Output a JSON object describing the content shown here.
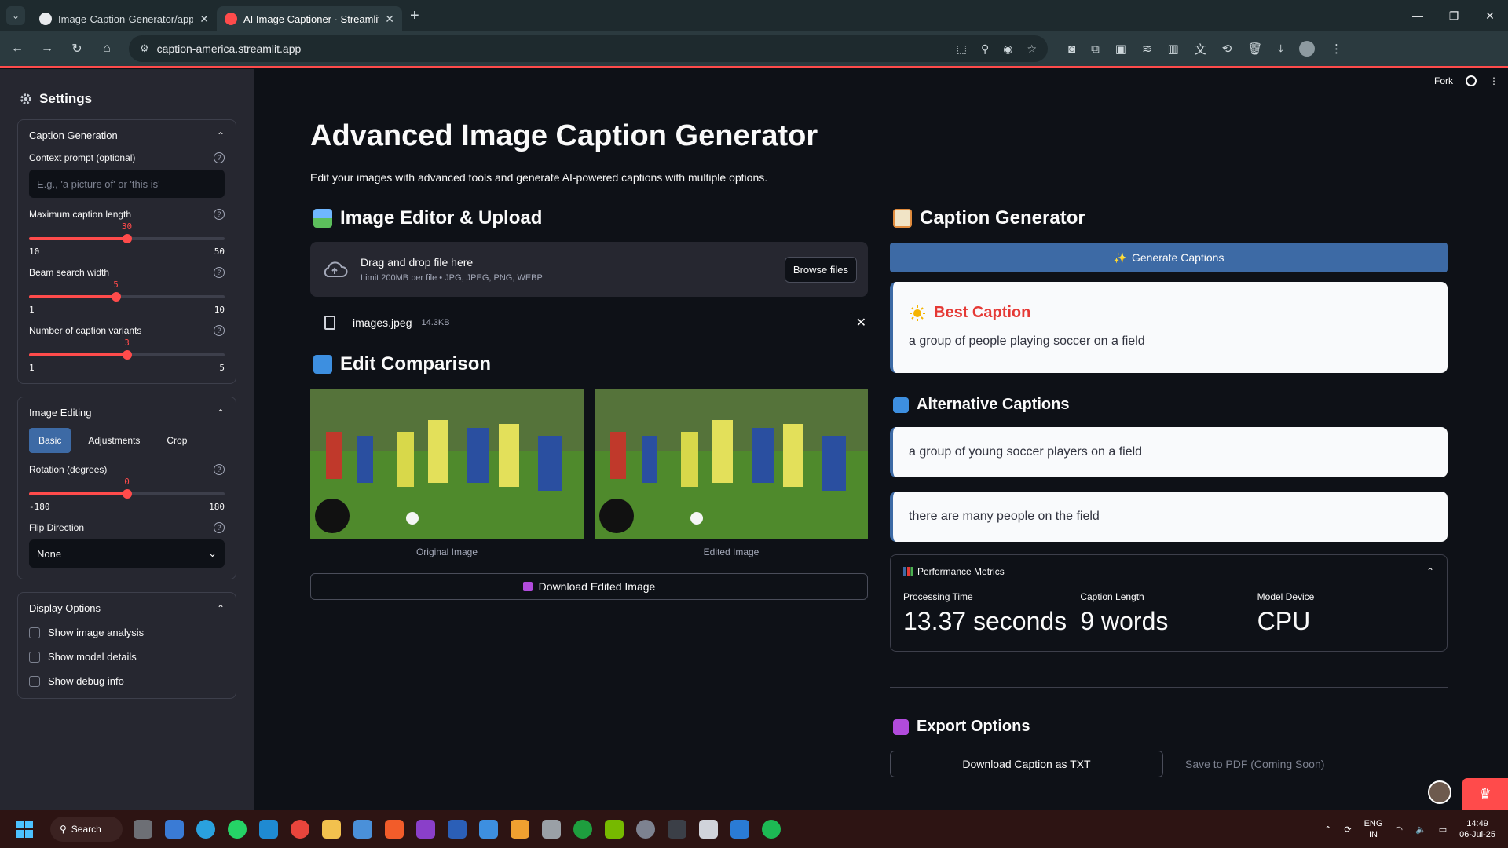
{
  "browser": {
    "tabs": [
      {
        "title": "Image-Caption-Generator/app",
        "active": false
      },
      {
        "title": "AI Image Captioner · Streamlit",
        "active": true
      }
    ],
    "url": "caption-america.streamlit.app"
  },
  "sidebar": {
    "title": "Settings",
    "caption_generation": {
      "header": "Caption Generation",
      "context_label": "Context prompt (optional)",
      "context_placeholder": "E.g., 'a picture of' or 'this is'",
      "max_len": {
        "label": "Maximum caption length",
        "value": "30",
        "min": "10",
        "max": "50",
        "fraction": 0.5
      },
      "beam": {
        "label": "Beam search width",
        "value": "5",
        "min": "1",
        "max": "10",
        "fraction": 0.444
      },
      "variants": {
        "label": "Number of caption variants",
        "value": "3",
        "min": "1",
        "max": "5",
        "fraction": 0.5
      }
    },
    "image_editing": {
      "header": "Image Editing",
      "tabs": [
        "Basic",
        "Adjustments",
        "Crop"
      ],
      "rotation": {
        "label": "Rotation (degrees)",
        "value": "0",
        "min": "-180",
        "max": "180",
        "fraction": 0.5
      },
      "flip_label": "Flip Direction",
      "flip_value": "None"
    },
    "display_options": {
      "header": "Display Options",
      "checks": [
        "Show image analysis",
        "Show model details",
        "Show debug info"
      ]
    }
  },
  "main": {
    "fork": "Fork",
    "title": "Advanced Image Caption Generator",
    "subtitle": "Edit your images with advanced tools and generate AI-powered captions with multiple options.",
    "editor_header": "Image Editor & Upload",
    "upload_main": "Drag and drop file here",
    "upload_limit": "Limit 200MB per file • JPG, JPEG, PNG, WEBP",
    "browse": "Browse files",
    "file_name": "images.jpeg",
    "file_size": "14.3KB",
    "compare_header": "Edit Comparison",
    "original_caption": "Original Image",
    "edited_caption": "Edited Image",
    "download_image": "Download Edited Image",
    "caption_header": "Caption Generator",
    "generate": "Generate Captions",
    "best_label": "Best Caption",
    "best_caption": "a group of people playing soccer on a field",
    "alt_header": "Alternative Captions",
    "alt_captions": [
      "a group of young soccer players on a field",
      "there are many people on the field"
    ],
    "metrics": {
      "header": "Performance Metrics",
      "items": [
        {
          "label": "Processing Time",
          "value": "13.37 seconds"
        },
        {
          "label": "Caption Length",
          "value": "9 words"
        },
        {
          "label": "Model Device",
          "value": "CPU"
        }
      ]
    },
    "export_header": "Export Options",
    "download_txt": "Download Caption as TXT",
    "pdf": "Save to PDF (Coming Soon)"
  },
  "taskbar": {
    "search": "Search",
    "lang_top": "ENG",
    "lang_bottom": "IN",
    "time": "14:49",
    "date": "06-Jul-25"
  },
  "colors": {
    "accent": "#ff4b4b",
    "primary_button": "#3d6aa5",
    "best_caption": "#e53935"
  }
}
